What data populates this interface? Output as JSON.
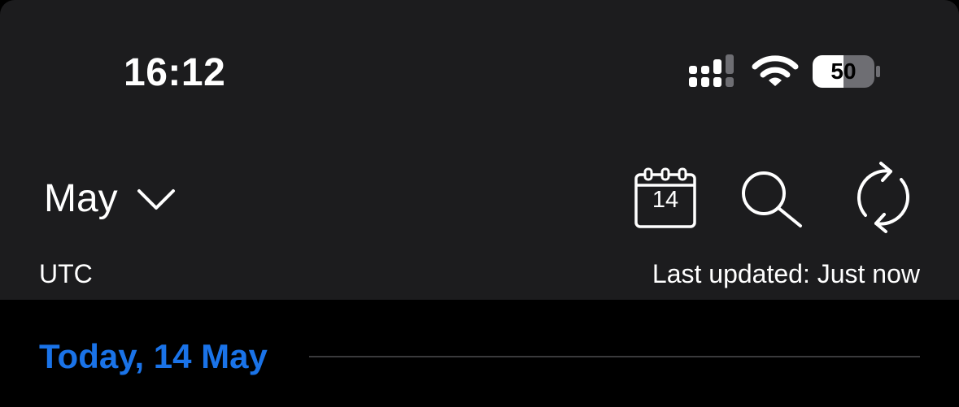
{
  "status_bar": {
    "time": "16:12",
    "battery_level": "50",
    "icons": [
      "signal-icon",
      "wifi-icon",
      "battery-icon"
    ]
  },
  "header": {
    "month": "May",
    "calendar_day": "14",
    "icons": [
      "chevron-down-icon",
      "calendar-icon",
      "search-icon",
      "refresh-icon"
    ]
  },
  "info_row": {
    "timezone": "UTC",
    "last_updated": "Last updated: Just now"
  },
  "section": {
    "date_title": "Today, 14 May"
  },
  "colors": {
    "panel_background": "#1c1c1e",
    "page_background": "#000000",
    "accent_blue": "#1a73e8",
    "divider": "#3a3a3c"
  }
}
